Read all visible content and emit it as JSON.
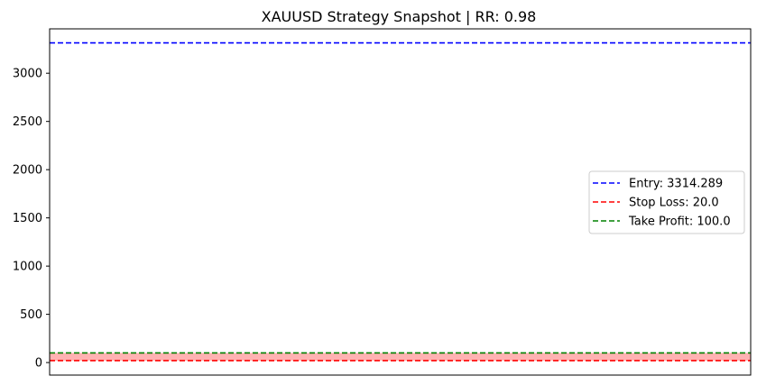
{
  "chart_data": {
    "type": "line",
    "title": "XAUUSD Strategy Snapshot | RR: 0.98",
    "xlabel": "",
    "ylabel": "",
    "ylim": [
      -130,
      3460
    ],
    "yticks": [
      0,
      500,
      1000,
      1500,
      2000,
      2500,
      3000
    ],
    "ytick_labels": [
      "0",
      "500",
      "1000",
      "1500",
      "2000",
      "2500",
      "3000"
    ],
    "xticks_visible": false,
    "grid": false,
    "legend_position": "center-right",
    "series": [
      {
        "name": "Entry: 3314.289",
        "value": 3314.289,
        "color": "#0000ff",
        "style": "dashed"
      },
      {
        "name": "Stop Loss: 20.0",
        "value": 20.0,
        "color": "#ff0000",
        "style": "dashed"
      },
      {
        "name": "Take Profit: 100.0",
        "value": 100.0,
        "color": "#008000",
        "style": "dashed"
      }
    ],
    "shaded_bands": [
      {
        "from": 20.0,
        "to": 100.0,
        "color": "#ff0000",
        "opacity": 0.3
      }
    ]
  }
}
